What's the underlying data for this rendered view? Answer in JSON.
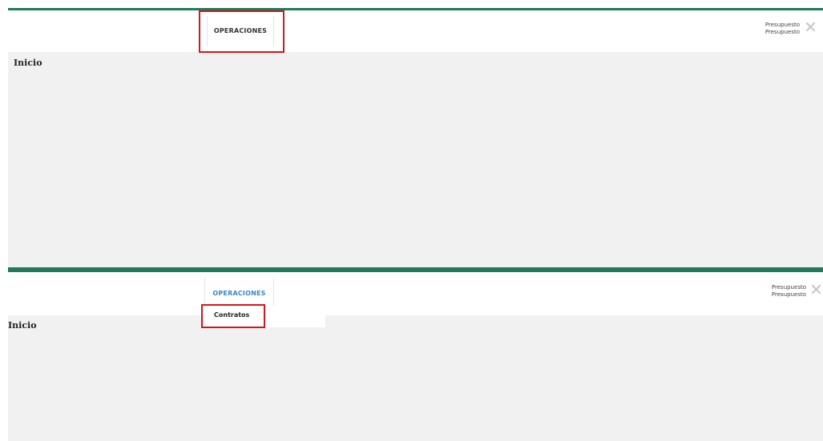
{
  "top_state": {
    "nav": {
      "menu_label": "OPERACIONES"
    },
    "user": {
      "line1": "Presupuesto",
      "line2": "Presupuesto",
      "close_icon": "close-x-icon"
    },
    "content": {
      "title": "Inicio"
    }
  },
  "bottom_state": {
    "nav": {
      "menu_label": "OPERACIONES"
    },
    "dropdown": {
      "items": [
        {
          "label": "Contratos"
        }
      ]
    },
    "user": {
      "line1": "Presupuesto",
      "line2": "Presupuesto",
      "close_icon": "close-x-icon"
    },
    "content": {
      "title": "Inicio"
    }
  },
  "colors": {
    "header_bar": "#1f7a5c",
    "content_bg": "#f1f1f1",
    "highlight": "#d8141a",
    "active_menu": "#3a87c6"
  }
}
